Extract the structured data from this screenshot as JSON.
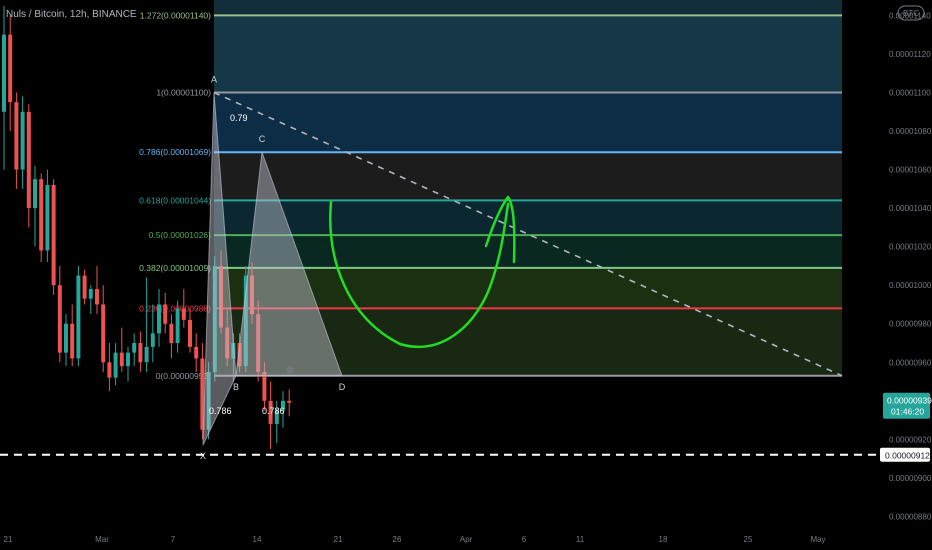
{
  "header": {
    "title": "Nuls / Bitcoin, 12h, BINANCE",
    "currency_badge": "BTC"
  },
  "chart_data": {
    "type": "candlestick",
    "y_unit": "BTC",
    "ylim": [
      8.74e-06,
      1.148e-05
    ],
    "y_ticks": [
      "0.00001140",
      "0.00001120",
      "0.00001100",
      "0.00001080",
      "0.00001060",
      "0.00001040",
      "0.00001020",
      "0.00001000",
      "0.00000980",
      "0.00000960",
      "0.00000920",
      "0.00000900",
      "0.00000880"
    ],
    "x_ticks": [
      "21",
      "Mar",
      "7",
      "14",
      "21",
      "26",
      "Apr",
      "6",
      "11",
      "18",
      "25",
      "May"
    ],
    "last_price": "0.00000939",
    "countdown": "01:46:20",
    "support_price": "0.00000912",
    "fib_levels": [
      {
        "label": "1.272(0.00001140)",
        "price": 1.14e-05
      },
      {
        "label": "1(0.00001100)",
        "price": 1.1e-05
      },
      {
        "label": "0.786(0.00001069)",
        "price": 1.069e-05
      },
      {
        "label": "0.618(0.00001044)",
        "price": 1.044e-05
      },
      {
        "label": "0.5(0.00001026)",
        "price": 1.026e-05
      },
      {
        "label": "0.382(0.00001009)",
        "price": 1.009e-05
      },
      {
        "label": "0.236(0.00000988)",
        "price": 9.88e-06
      },
      {
        "label": "0(0.00000953)",
        "price": 9.53e-06
      }
    ],
    "fib_colors": [
      "#9dbf8c",
      "#9598a1",
      "#64b5f6",
      "#26a69a",
      "#4caf50",
      "#81c784",
      "#f23645",
      "#9598a1"
    ],
    "fib_fills": [
      "#163a4a",
      "#0e2e4a",
      "#1e1e1e",
      "#0c2a33",
      "#0a2a24",
      "#1c3312",
      "#1a2a14",
      "#4a1111"
    ],
    "harmonic_points": [
      {
        "label": "X",
        "price": 9.17e-06
      },
      {
        "label": "A",
        "price": 1.1e-05
      },
      {
        "label": "B",
        "price": 9.53e-06
      },
      {
        "label": "C",
        "price": 1.069e-05
      },
      {
        "label": "D",
        "price": 9.53e-06
      }
    ],
    "ratio_labels": [
      "0.79",
      "0.786",
      "0.786"
    ],
    "candles": [
      [
        1.09e-05,
        1.145e-05,
        1.06e-05,
        1.13e-05
      ],
      [
        1.13e-05,
        1.14e-05,
        1.08e-05,
        1.095e-05
      ],
      [
        1.095e-05,
        1.1e-05,
        1.05e-05,
        1.06e-05
      ],
      [
        1.06e-05,
        1.098e-05,
        1.05e-05,
        1.09e-05
      ],
      [
        1.09e-05,
        1.094e-05,
        1.03e-05,
        1.04e-05
      ],
      [
        1.04e-05,
        1.062e-05,
        1.02e-05,
        1.055e-05
      ],
      [
        1.055e-05,
        1.058e-05,
        1.012e-05,
        1.018e-05
      ],
      [
        1.018e-05,
        1.06e-05,
        1.012e-05,
        1.052e-05
      ],
      [
        1.052e-05,
        1.055e-05,
        9.95e-06,
        1e-05
      ],
      [
        1e-05,
        1.01e-05,
        9.6e-06,
        9.65e-06
      ],
      [
        9.65e-06,
        9.85e-06,
        9.58e-06,
        9.8e-06
      ],
      [
        9.8e-06,
        9.9e-06,
        9.58e-06,
        9.62e-06
      ],
      [
        9.62e-06,
        1.01e-05,
        9.58e-06,
        1.005e-05
      ],
      [
        1.005e-05,
        1.008e-05,
        9.9e-06,
        9.93e-06
      ],
      [
        9.93e-06,
        1e-05,
        9.85e-06,
        9.98e-06
      ],
      [
        9.98e-06,
        1.01e-05,
        9.85e-06,
        9.9e-06
      ],
      [
        9.9e-06,
        1e-05,
        9.55e-06,
        9.6e-06
      ],
      [
        9.6e-06,
        9.7e-06,
        9.45e-06,
        9.52e-06
      ],
      [
        9.52e-06,
        9.7e-06,
        9.48e-06,
        9.65e-06
      ],
      [
        9.65e-06,
        9.78e-06,
        9.55e-06,
        9.58e-06
      ],
      [
        9.58e-06,
        9.68e-06,
        9.5e-06,
        9.65e-06
      ],
      [
        9.65e-06,
        9.75e-06,
        9.58e-06,
        9.7e-06
      ],
      [
        9.7e-06,
        9.76e-06,
        9.55e-06,
        9.6e-06
      ],
      [
        9.6e-06,
        1.004e-05,
        9.55e-06,
        9.68e-06
      ],
      [
        9.68e-06,
        9.9e-06,
        9.6e-06,
        9.75e-06
      ],
      [
        9.75e-06,
        9.98e-06,
        9.68e-06,
        9.9e-06
      ],
      [
        9.9e-06,
        9.96e-06,
        9.75e-06,
        9.8e-06
      ],
      [
        9.8e-06,
        9.85e-06,
        9.62e-06,
        9.7e-06
      ],
      [
        9.7e-06,
        9.92e-06,
        9.65e-06,
        9.88e-06
      ],
      [
        9.88e-06,
        9.98e-06,
        9.78e-06,
        9.82e-06
      ],
      [
        9.82e-06,
        9.88e-06,
        9.65e-06,
        9.68e-06
      ],
      [
        9.68e-06,
        9.75e-06,
        9.55e-06,
        9.62e-06
      ],
      [
        9.62e-06,
        9.7e-06,
        9.2e-06,
        9.25e-06
      ],
      [
        9.25e-06,
        9.6e-06,
        9.2e-06,
        9.55e-06
      ],
      [
        9.55e-06,
        1.015e-05,
        9.5e-06,
        1.01e-05
      ],
      [
        1.01e-05,
        1.018e-05,
        9.75e-06,
        9.78e-06
      ],
      [
        9.78e-06,
        9.88e-06,
        9.58e-06,
        9.62e-06
      ],
      [
        9.62e-06,
        9.75e-06,
        9.5e-06,
        9.7e-06
      ],
      [
        9.7e-06,
        9.75e-06,
        9.55e-06,
        9.58e-06
      ],
      [
        9.58e-06,
        1.01e-05,
        9.55e-06,
        1.005e-05
      ],
      [
        1.005e-05,
        1.012e-05,
        9.8e-06,
        9.85e-06
      ],
      [
        9.85e-06,
        9.92e-06,
        9.5e-06,
        9.55e-06
      ],
      [
        9.55e-06,
        9.6e-06,
        9.35e-06,
        9.4e-06
      ],
      [
        9.4e-06,
        9.5e-06,
        9.15e-06,
        9.28e-06
      ],
      [
        9.28e-06,
        9.4e-06,
        9.18e-06,
        9.35e-06
      ],
      [
        9.35e-06,
        9.45e-06,
        9.26e-06,
        9.4e-06
      ],
      [
        9.4e-06,
        9.46e-06,
        9.32e-06,
        9.39e-06
      ]
    ]
  }
}
